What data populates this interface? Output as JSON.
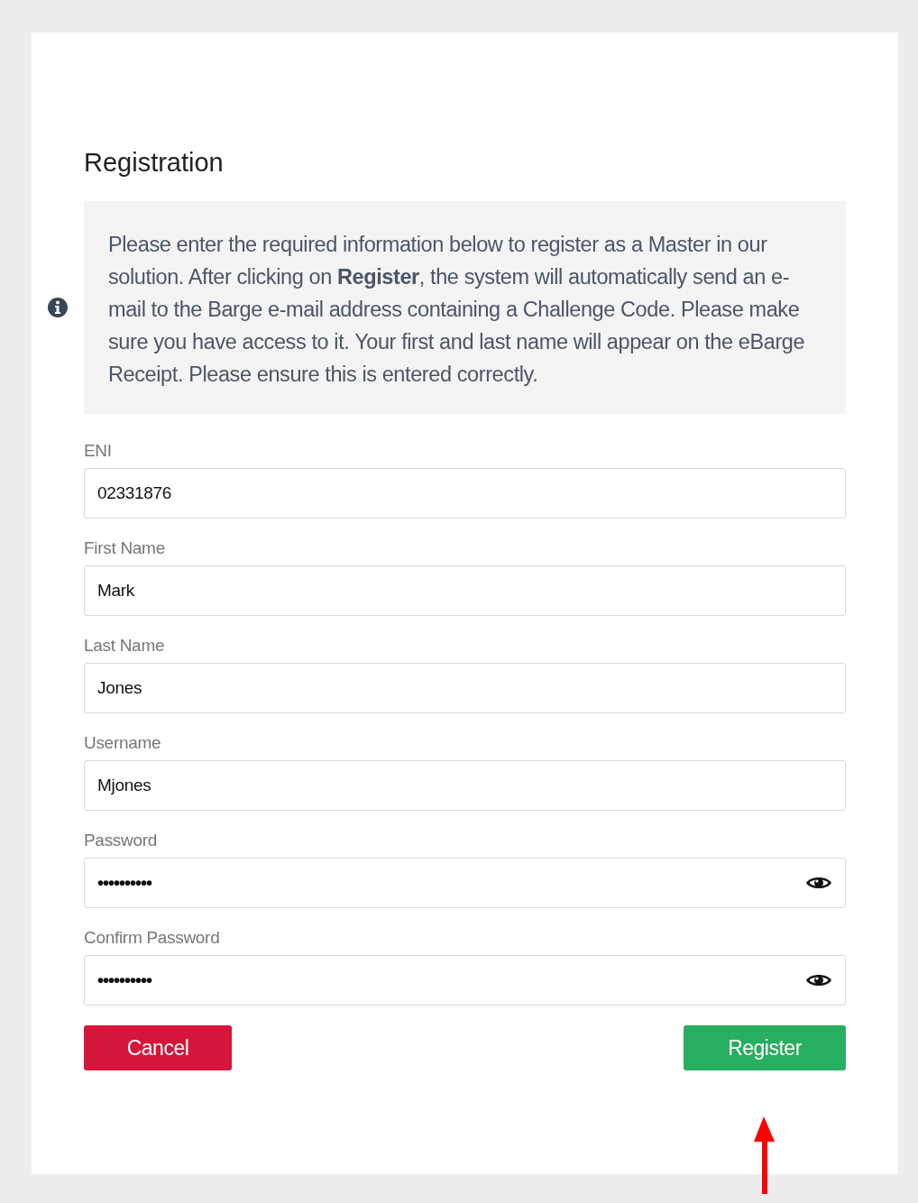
{
  "title": "Registration",
  "info": {
    "text": "Please enter the required information below to register as a Master in our solution. After clicking on **Register**, the system will automatically send an e-mail to the Barge e-mail address containing a Challenge Code. Please make sure you have access to it. Your first and last name will appear on the eBarge Receipt. Please ensure this is entered correctly."
  },
  "fields": [
    {
      "label": "ENI",
      "value": "02331876",
      "kind": "text"
    },
    {
      "label": "First Name",
      "value": "Mark",
      "kind": "text"
    },
    {
      "label": "Last Name",
      "value": "Jones",
      "kind": "text"
    },
    {
      "label": "Username",
      "value": "Mjones",
      "kind": "text"
    },
    {
      "label": "Password",
      "value": "••••••••••",
      "kind": "password"
    },
    {
      "label": "Confirm Password",
      "value": "••••••••••",
      "kind": "password"
    }
  ],
  "buttons": [
    {
      "label": "Cancel",
      "kind": "cancel"
    },
    {
      "label": "Register",
      "kind": "primary"
    }
  ]
}
